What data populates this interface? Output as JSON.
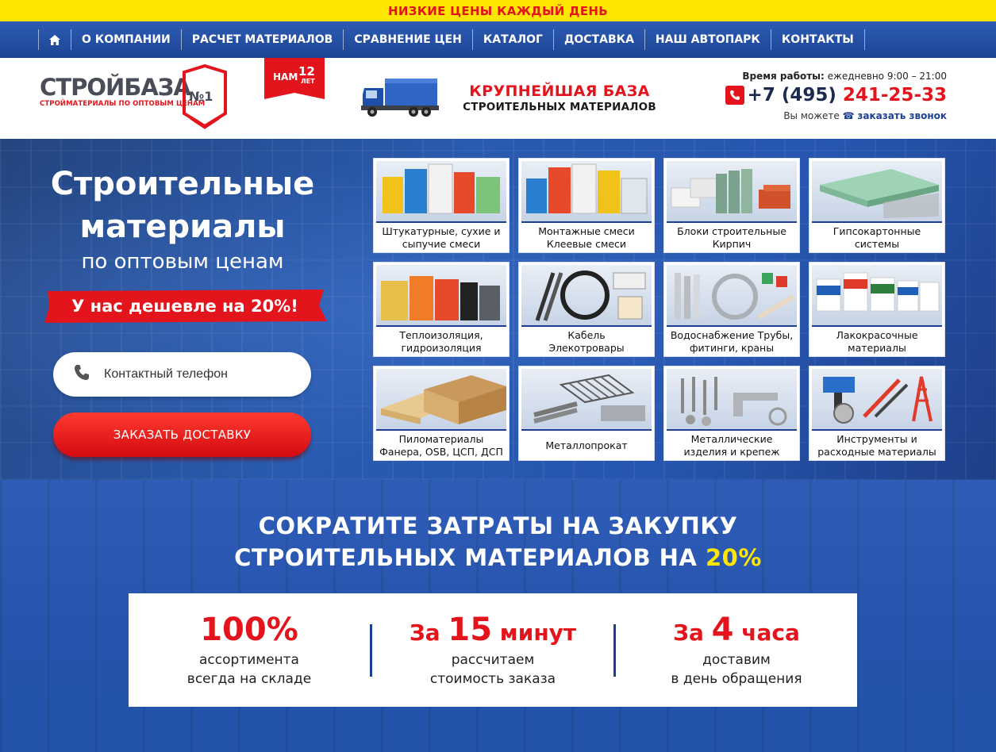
{
  "promo": {
    "text": "НИЗКИЕ ЦЕНЫ КАЖДЫЙ ДЕНЬ"
  },
  "nav": {
    "items": [
      {
        "label": "О КОМПАНИИ"
      },
      {
        "label": "РАСЧЕТ МАТЕРИАЛОВ"
      },
      {
        "label": "СРАВНЕНИЕ ЦЕН"
      },
      {
        "label": "КАТАЛОГ"
      },
      {
        "label": "ДОСТАВКА"
      },
      {
        "label": "НАШ АВТОПАРК"
      },
      {
        "label": "КОНТАКТЫ"
      }
    ]
  },
  "header": {
    "logo_title": "СТРОЙБАЗА",
    "logo_badge": "№1",
    "logo_sub": "СТРОЙМАТЕРИАЛЫ ПО ОПТОВЫМ ЦЕНАМ",
    "years_prefix": "НАМ",
    "years_number": "12",
    "years_suffix": "ЛЕТ",
    "tagline_main": "КРУПНЕЙШАЯ БАЗА",
    "tagline_sub": "СТРОИТЕЛЬНЫХ МАТЕРИАЛОВ",
    "hours_label": "Время работы:",
    "hours_value": "ежедневно 9:00 – 21:00",
    "phone_code": "+7 (495)",
    "phone_number": "241-25-33",
    "callback_prefix": "Вы можете",
    "callback_link": "заказать звонок"
  },
  "hero": {
    "title_line1": "Строительные",
    "title_line2": "материалы",
    "subtitle": "по оптовым ценам",
    "ribbon": "У нас дешевле на 20%!",
    "phone_placeholder": "Контактный телефон",
    "order_button": "ЗАКАЗАТЬ ДОСТАВКУ"
  },
  "catalog": [
    {
      "line1": "Штукатурные, сухие и",
      "line2": "сыпучие смеси"
    },
    {
      "line1": "Монтажные смеси",
      "line2": "Клеевые смеси"
    },
    {
      "line1": "Блоки строительные",
      "line2": "Кирпич"
    },
    {
      "line1": "Гипсокартонные",
      "line2": "системы"
    },
    {
      "line1": "Теплоизоляция,",
      "line2": "гидроизоляция"
    },
    {
      "line1": "Кабель",
      "line2": "Элекотровары"
    },
    {
      "line1": "Водоснабжение Трубы,",
      "line2": "фитинги, краны"
    },
    {
      "line1": "Лакокрасочные",
      "line2": "материалы"
    },
    {
      "line1": "Пиломатериалы",
      "line2": "Фанера, OSB, ЦСП, ДСП"
    },
    {
      "line1": "Металлопрокат",
      "line2": ""
    },
    {
      "line1": "Металлические",
      "line2": "изделия и крепеж"
    },
    {
      "line1": "Инструменты и",
      "line2": "расходные материалы"
    }
  ],
  "savings": {
    "title_line1": "СОКРАТИТЕ ЗАТРАТЫ НА ЗАКУПКУ",
    "title_line2": "СТРОИТЕЛЬНЫХ МАТЕРИАЛОВ НА",
    "title_accent": "20%",
    "stats": [
      {
        "prefix": "",
        "num": "100%",
        "suffix": "",
        "line1": "ассортимента",
        "line2": "всегда на складе"
      },
      {
        "prefix": "За ",
        "num": "15",
        "suffix": " минут",
        "line1": "рассчитаем",
        "line2": "стоимость заказа"
      },
      {
        "prefix": "За ",
        "num": "4",
        "suffix": " часа",
        "line1": "доставим",
        "line2": "в день обращения"
      }
    ]
  },
  "colors": {
    "brand_red": "#e3141b",
    "brand_blue": "#1d3f8f",
    "promo_yellow": "#ffe600"
  },
  "icons": {
    "home": "home-icon",
    "phone": "phone-icon",
    "handset": "handset-icon"
  }
}
